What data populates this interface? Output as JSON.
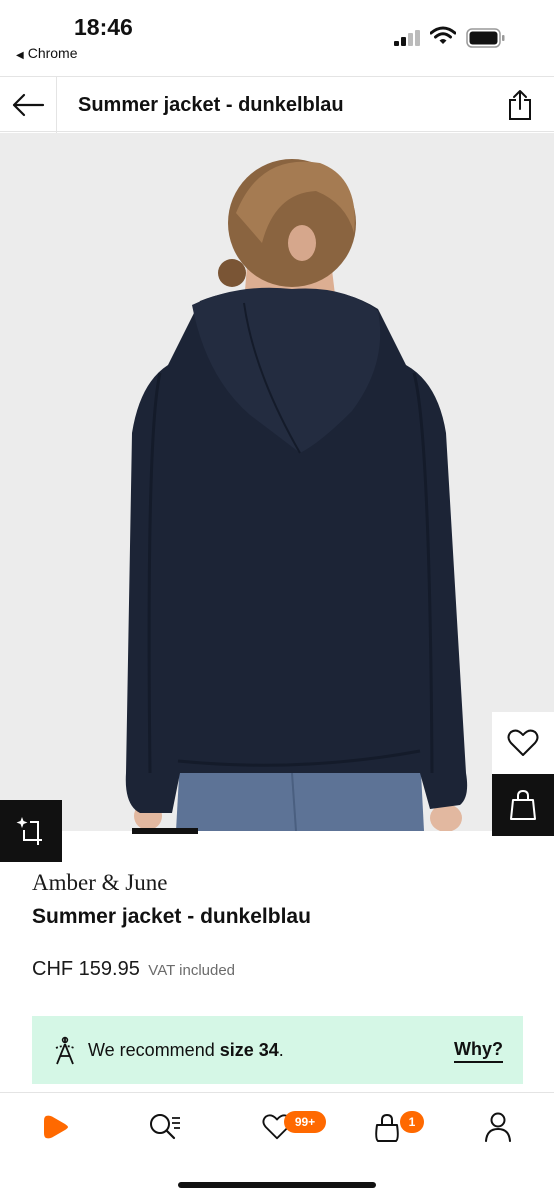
{
  "status_bar": {
    "time": "18:46",
    "back_app": "Chrome",
    "back_arrow": "◀"
  },
  "header": {
    "title": "Summer jacket - dunkelblau",
    "back_icon": "arrow-left-icon",
    "share_icon": "share-icon"
  },
  "product": {
    "image_subject": "navy hooded jacket, back view",
    "brand": "Amber & June",
    "name": "Summer jacket - dunkelblau",
    "price": "CHF 159.95",
    "vat_note": "VAT included"
  },
  "recommendation": {
    "prefix": "We recommend",
    "size": "size 34",
    "suffix": ".",
    "why_label": "Why?",
    "background": "#d5f7e6"
  },
  "tabs": [
    {
      "name": "home",
      "icon": "home-play-icon"
    },
    {
      "name": "search",
      "icon": "search-icon"
    },
    {
      "name": "wishlist",
      "icon": "heart-icon",
      "badge": "99+"
    },
    {
      "name": "bag",
      "icon": "bag-icon",
      "badge": "1"
    },
    {
      "name": "profile",
      "icon": "person-icon"
    }
  ],
  "colors": {
    "accent": "#ff6900",
    "jacket": "#1c2436",
    "image_bg": "#ececec"
  }
}
